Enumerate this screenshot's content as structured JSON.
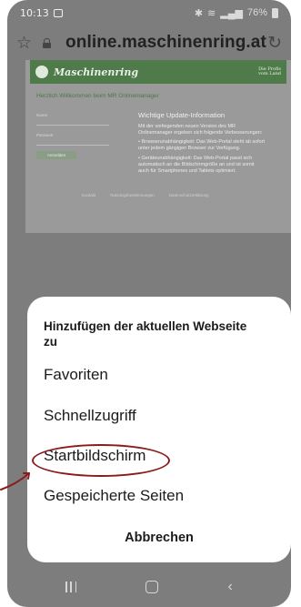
{
  "status_bar": {
    "time": "10:13",
    "battery": "76%"
  },
  "browser": {
    "url": "online.maschinenring.at"
  },
  "webpage": {
    "brand": "Maschinenring",
    "slogan": "Die Profis vom Land",
    "welcome": "Herzlich Willkommen beim MR Onlinemanager",
    "login": {
      "name_label": "Name",
      "password_label": "Passwort",
      "button": "Anmelden"
    },
    "info": {
      "title": "Wichtige Update-Information",
      "p1": "Mit der vorliegenden neuen Version des MR Onlinemanager ergeben sich folgende Verbesserungen:",
      "p2": "• Browserunabhängigkeit: Das Web-Portal steht ab sofort unter jedem gängigen Browser zur Verfügung.",
      "p3": "• Geräteunabhängigkeit: Das Web-Portal passt sich automatisch an die Bildschirmgröße an und ist somit auch für Smartphones und Tablets optimiert."
    },
    "footer": [
      "Kontakt",
      "Nutzungsbestimmungen",
      "Datenschutzerklärung"
    ]
  },
  "sheet": {
    "title": "Hinzufügen der aktuellen Webseite zu",
    "options": [
      "Favoriten",
      "Schnellzugriff",
      "Startbildschirm",
      "Gespeicherte Seiten"
    ],
    "cancel": "Abbrechen"
  },
  "colors": {
    "highlight": "#8a1c1c",
    "brand_green": "#4f7a4a"
  },
  "icons": {
    "bookmark": "star-outline-icon",
    "secure": "lock-icon",
    "refresh": "reload-icon",
    "nav_recent": "recent-apps-icon",
    "nav_home": "home-icon",
    "nav_back": "back-icon"
  }
}
